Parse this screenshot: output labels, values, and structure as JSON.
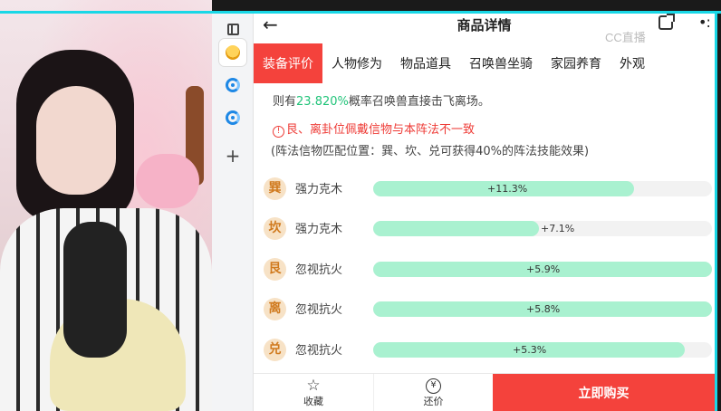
{
  "page": {
    "title": "商品详情",
    "watermark": "CC直播"
  },
  "tabs": [
    {
      "label": "装备评价",
      "active": true
    },
    {
      "label": "人物修为",
      "active": false
    },
    {
      "label": "物品道具",
      "active": false
    },
    {
      "label": "召唤兽坐骑",
      "active": false
    },
    {
      "label": "家园养育",
      "active": false
    },
    {
      "label": "外观",
      "active": false
    }
  ],
  "info": {
    "line1_prefix": "则有",
    "line1_pct": "23.820%",
    "line1_suffix": "概率召唤兽直接击飞离场。",
    "warning_icon": "!",
    "warning": "艮、离卦位佩戴信物与本阵法不一致",
    "note": "(阵法信物匹配位置：巽、坎、兑可获得40%的阵法技能效果)"
  },
  "rows": [
    {
      "badge": "巽",
      "attr": "强力克木",
      "value": "+11.3%",
      "fill": 0.77
    },
    {
      "badge": "坎",
      "attr": "强力克木",
      "value": "+7.1%",
      "fill": 0.49
    },
    {
      "badge": "艮",
      "attr": "忽视抗火",
      "value": "+5.9%",
      "fill": 1.0
    },
    {
      "badge": "离",
      "attr": "忽视抗火",
      "value": "+5.8%",
      "fill": 1.0
    },
    {
      "badge": "兑",
      "attr": "忽视抗火",
      "value": "+5.3%",
      "fill": 0.92
    }
  ],
  "bottom": {
    "favorite_label": "收藏",
    "bargain_label": "还价",
    "bargain_glyph": "¥",
    "buy_label": "立即购买"
  },
  "colors": {
    "accent": "#f4423c",
    "bar_fill": "#a9f1d0",
    "highlight_green": "#22c47a",
    "frame_cyan": "#19d7e6"
  }
}
